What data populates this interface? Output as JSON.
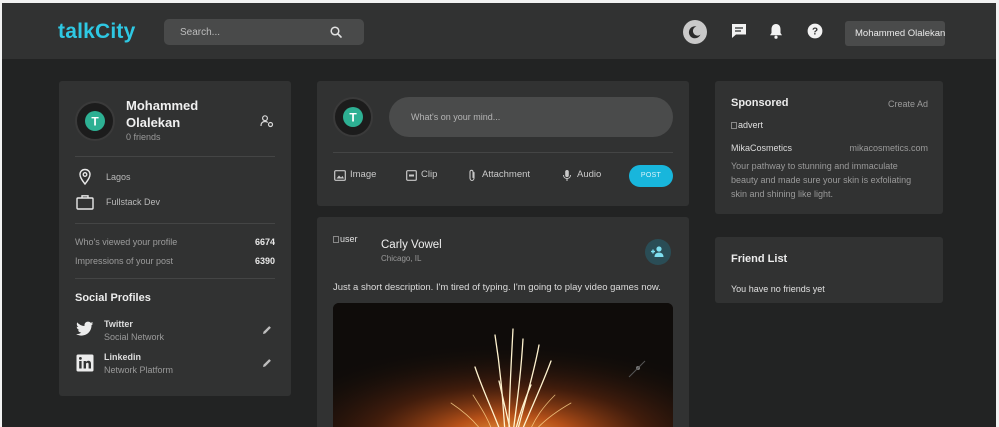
{
  "navbar": {
    "logo": "talkCity",
    "search_placeholder": "Search...",
    "user_select": "Mohammed Olalekan",
    "icons": [
      "moon-icon",
      "message-icon",
      "bell-icon",
      "help-icon"
    ]
  },
  "profile": {
    "name_line1": "Mohammed",
    "name_line2": "Olalekan",
    "friends": "0 friends",
    "location": "Lagos",
    "occupation": "Fullstack Dev",
    "stats": [
      {
        "label": "Who's viewed your profile",
        "value": "6674"
      },
      {
        "label": "Impressions of your post",
        "value": "6390"
      }
    ],
    "social_title": "Social Profiles",
    "socials": [
      {
        "name": "Twitter",
        "type": "Social Network"
      },
      {
        "name": "Linkedin",
        "type": "Network Platform"
      }
    ]
  },
  "composer": {
    "placeholder": "What's on your mind...",
    "actions": [
      "Image",
      "Clip",
      "Attachment",
      "Audio"
    ],
    "post_label": "POST"
  },
  "feed_post": {
    "avatar_alt": "user",
    "author": "Carly Vowel",
    "location": "Chicago, IL",
    "description": "Just a short description. I'm tired of typing. I'm going to play video games now."
  },
  "sponsored": {
    "title": "Sponsored",
    "create_ad": "Create Ad",
    "image_alt": "advert",
    "brand": "MikaCosmetics",
    "site": "mikacosmetics.com",
    "text_lines": [
      "Your pathway to stunning and immaculate",
      "beauty and made sure your skin is exfoliating",
      "skin and shining like light."
    ]
  },
  "friends": {
    "title": "Friend List",
    "empty_text": "You have no friends yet"
  },
  "colors": {
    "accent": "#2ec8e3",
    "background": "#222323",
    "card": "#313232",
    "post_button": "#18b6dc"
  }
}
